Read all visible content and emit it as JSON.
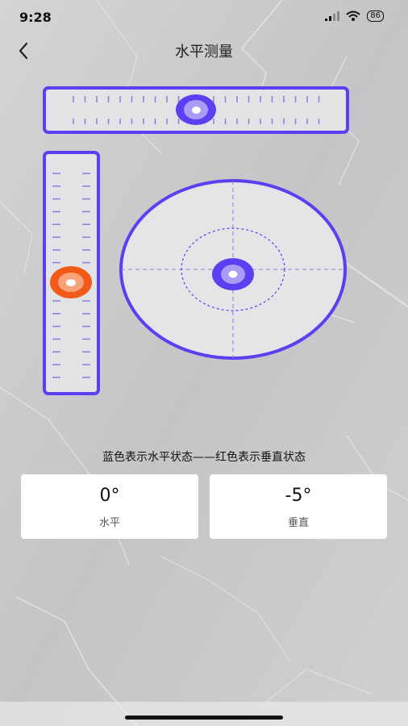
{
  "status_bar": {
    "time": "9:28",
    "battery": "86",
    "icons": [
      "signal-icon",
      "wifi-icon",
      "battery-icon"
    ]
  },
  "header": {
    "title": "水平测量",
    "back_icon": "chevron-left-icon"
  },
  "level": {
    "accent_color": "#5b3ff0",
    "horizontal_color": "#5b3ff0",
    "vertical_color": "#f25a18",
    "horizontal_bubble_position": 0.5,
    "vertical_bubble_position": 0.54
  },
  "legend": "蓝色表示水平状态——红色表示垂直状态",
  "readings": [
    {
      "value": "0°",
      "label": "水平"
    },
    {
      "value": "-5°",
      "label": "垂直"
    }
  ]
}
